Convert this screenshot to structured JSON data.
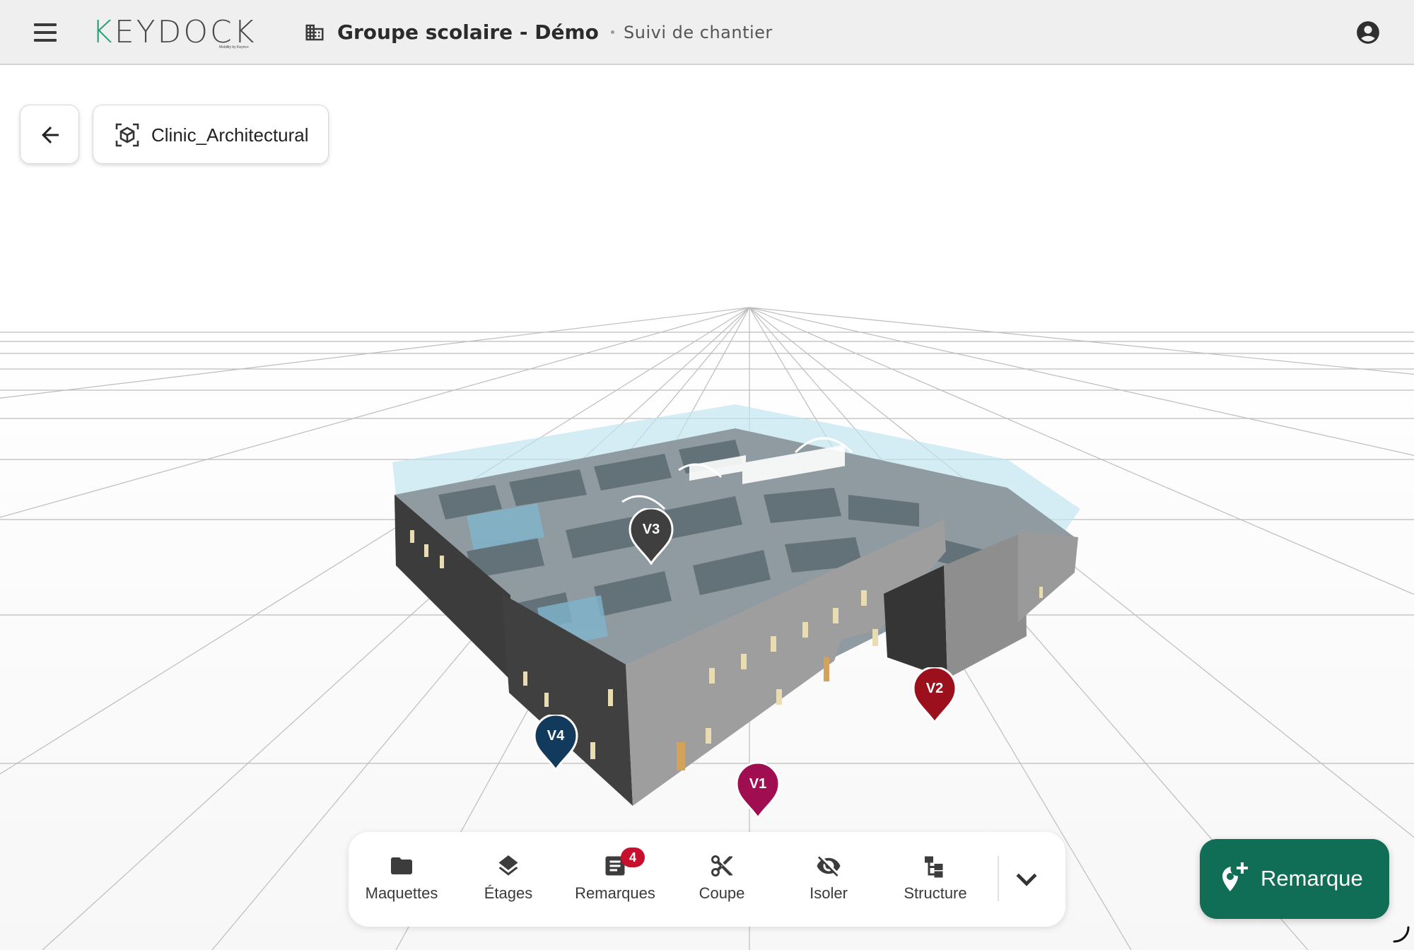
{
  "header": {
    "app_name": "KEYDOCK",
    "logo_tagline": "Mobility by Keynco",
    "project_title": "Groupe scolaire - Démo",
    "page_subtitle": "Suivi de chantier"
  },
  "model": {
    "name": "Clinic_Architectural"
  },
  "markers": [
    {
      "label": "V3",
      "color": "#3f3f3f"
    },
    {
      "label": "V2",
      "color": "#9c0f1c"
    },
    {
      "label": "V4",
      "color": "#123a5c"
    },
    {
      "label": "V1",
      "color": "#a00d50"
    }
  ],
  "toolbar": {
    "items": [
      {
        "label": "Maquettes",
        "icon": "folder-icon"
      },
      {
        "label": "Étages",
        "icon": "layers-icon"
      },
      {
        "label": "Remarques",
        "icon": "notes-icon",
        "badge": "4"
      },
      {
        "label": "Coupe",
        "icon": "scissors-icon"
      },
      {
        "label": "Isoler",
        "icon": "eye-off-icon"
      },
      {
        "label": "Structure",
        "icon": "structure-icon"
      }
    ]
  },
  "fab": {
    "label": "Remarque"
  },
  "colors": {
    "brand_green": "#0f6e55",
    "badge_red": "#c8102e",
    "logo_accent": "#2a9d7a"
  }
}
